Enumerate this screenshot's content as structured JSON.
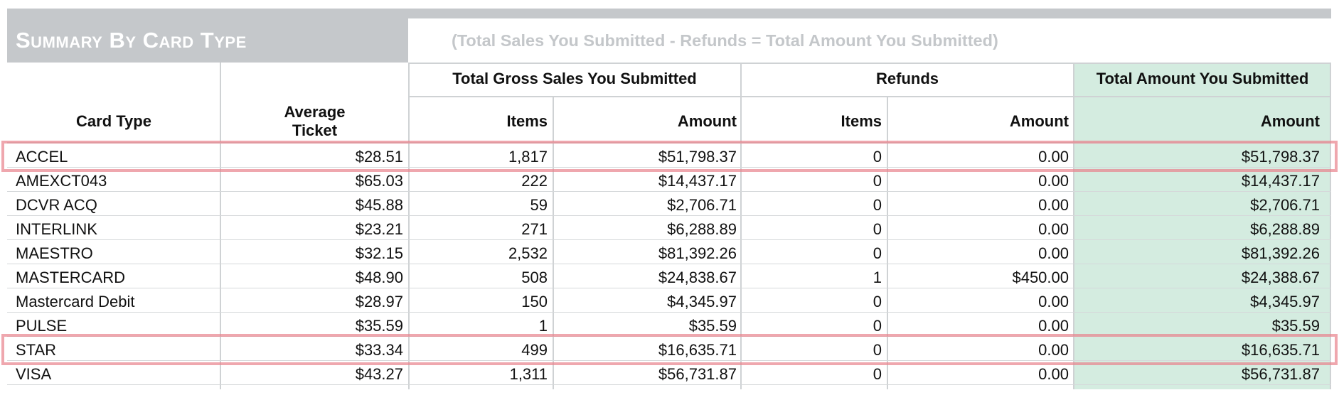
{
  "header": {
    "title": "Summary By Card Type",
    "formula": "(Total Sales You Submitted - Refunds = Total Amount You Submitted)"
  },
  "columns": {
    "card_type": "Card Type",
    "average_ticket": "Average Ticket",
    "gross_group": "Total Gross Sales You Submitted",
    "refunds_group": "Refunds",
    "total_group": "Total Amount You Submitted",
    "items": "Items",
    "amount": "Amount"
  },
  "rows": [
    {
      "card": "ACCEL",
      "avg": "$28.51",
      "gross_items": "1,817",
      "gross_amount": "$51,798.37",
      "ref_items": "0",
      "ref_amount": "0.00",
      "total": "$51,798.37",
      "highlighted": true
    },
    {
      "card": "AMEXCT043",
      "avg": "$65.03",
      "gross_items": "222",
      "gross_amount": "$14,437.17",
      "ref_items": "0",
      "ref_amount": "0.00",
      "total": "$14,437.17",
      "highlighted": false
    },
    {
      "card": "DCVR ACQ",
      "avg": "$45.88",
      "gross_items": "59",
      "gross_amount": "$2,706.71",
      "ref_items": "0",
      "ref_amount": "0.00",
      "total": "$2,706.71",
      "highlighted": false
    },
    {
      "card": "INTERLINK",
      "avg": "$23.21",
      "gross_items": "271",
      "gross_amount": "$6,288.89",
      "ref_items": "0",
      "ref_amount": "0.00",
      "total": "$6,288.89",
      "highlighted": false
    },
    {
      "card": "MAESTRO",
      "avg": "$32.15",
      "gross_items": "2,532",
      "gross_amount": "$81,392.26",
      "ref_items": "0",
      "ref_amount": "0.00",
      "total": "$81,392.26",
      "highlighted": false
    },
    {
      "card": "MASTERCARD",
      "avg": "$48.90",
      "gross_items": "508",
      "gross_amount": "$24,838.67",
      "ref_items": "1",
      "ref_amount": "$450.00",
      "total": "$24,388.67",
      "highlighted": false
    },
    {
      "card": "Mastercard Debit",
      "avg": "$28.97",
      "gross_items": "150",
      "gross_amount": "$4,345.97",
      "ref_items": "0",
      "ref_amount": "0.00",
      "total": "$4,345.97",
      "highlighted": false
    },
    {
      "card": "PULSE",
      "avg": "$35.59",
      "gross_items": "1",
      "gross_amount": "$35.59",
      "ref_items": "0",
      "ref_amount": "0.00",
      "total": "$35.59",
      "highlighted": false
    },
    {
      "card": "STAR",
      "avg": "$33.34",
      "gross_items": "499",
      "gross_amount": "$16,635.71",
      "ref_items": "0",
      "ref_amount": "0.00",
      "total": "$16,635.71",
      "highlighted": true
    },
    {
      "card": "VISA",
      "avg": "$43.27",
      "gross_items": "1,311",
      "gross_amount": "$56,731.87",
      "ref_items": "0",
      "ref_amount": "0.00",
      "total": "$56,731.87",
      "highlighted": false
    }
  ],
  "colors": {
    "title_band": "#c5c8cb",
    "total_column": "#d4ece0",
    "highlight_box": "#e8828c"
  }
}
